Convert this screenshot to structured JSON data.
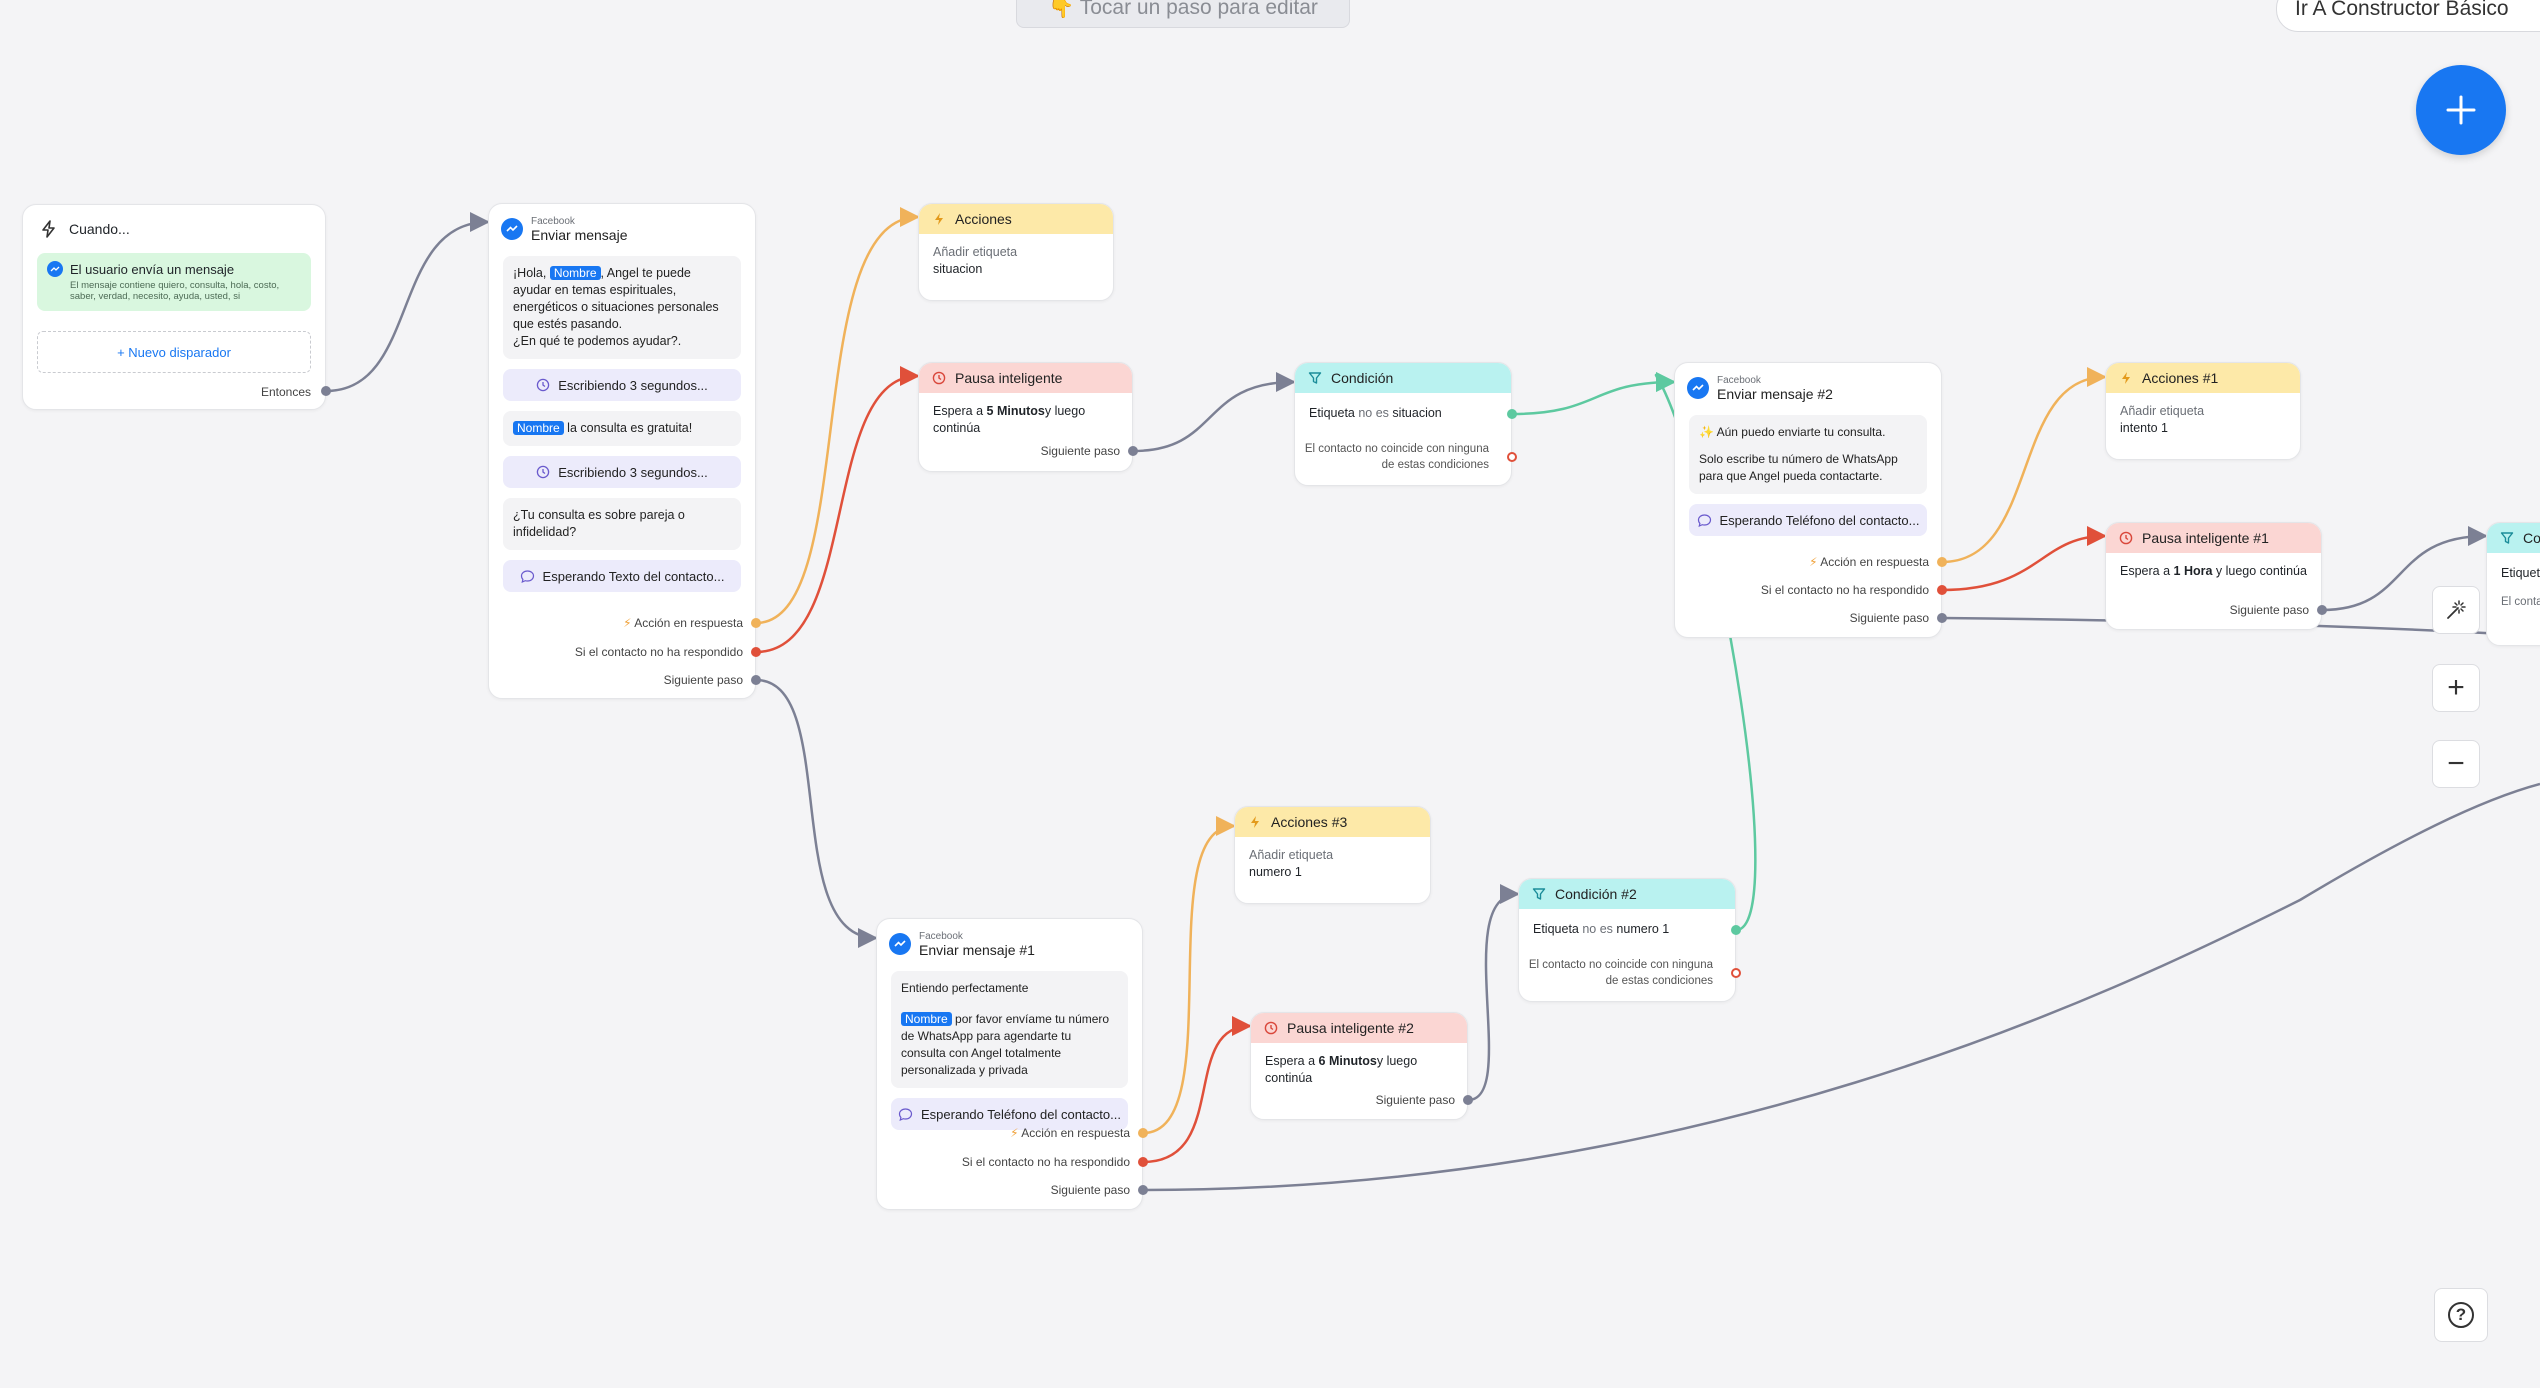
{
  "hint_banner": "👇 Tocar un paso para editar",
  "top_right_button": "Ir A Constructor Básico",
  "colors": {
    "facebook": "#1877f2",
    "yellow": "#fde9a8",
    "red": "#fbd6d3",
    "cyan": "#b9f2f0",
    "wire_gray": "#7c8094",
    "wire_orange": "#f0b25a",
    "wire_red": "#e0503a",
    "wire_green": "#5dc9a0"
  },
  "trigger": {
    "title": "Cuando...",
    "event_title": "El usuario envía un mensaje",
    "event_detail": "El mensaje contiene quiero, consulta, hola, costo, saber, verdad, necesito, ayuda, usted, si",
    "add_trigger": "+ Nuevo disparador",
    "port_then": "Entonces"
  },
  "msg1": {
    "source": "Facebook",
    "title": "Enviar mensaje",
    "b1_pre": "¡Hola, ",
    "b1_name": "Nombre",
    "b1_post": ", Angel te puede ayudar en temas espirituales, energéticos o situaciones personales que estés pasando.",
    "b1_line2": "¿En qué te podemos ayudar?.",
    "typing1": "Escribiendo 3 segundos...",
    "b2_name": "Nombre",
    "b2_post": " la consulta es gratuita!",
    "typing2": "Escribiendo 3 segundos...",
    "b3": "¿Tu consulta es sobre pareja o infidelidad?",
    "waiting": "Esperando Texto del contacto...",
    "port_action": "Acción en respuesta",
    "port_no_reply": "Si el contacto no ha respondido",
    "port_next": "Siguiente paso"
  },
  "actions": {
    "title": "Acciones",
    "label": "Añadir etiqueta",
    "value": "situacion"
  },
  "pause": {
    "title": "Pausa inteligente",
    "pre": "Espera a ",
    "bold": "5 Minutos",
    "post": "y luego continúa",
    "port_next": "Siguiente paso"
  },
  "condition": {
    "title": "Condición",
    "pre": "Etiqueta ",
    "mid": "no es",
    "value": "situacion",
    "else_text": "El contacto no coincide con ninguna de estas condiciones"
  },
  "msg2": {
    "source": "Facebook",
    "title": "Enviar mensaje #2",
    "line1": "✨ Aún puedo enviarte tu consulta.",
    "line2": "Solo escribe tu número de WhatsApp para que Angel pueda contactarte.",
    "waiting": "Esperando Teléfono del contacto...",
    "port_action": "Acción en respuesta",
    "port_no_reply": "Si el contacto no ha respondido",
    "port_next": "Siguiente paso"
  },
  "actions1": {
    "title": "Acciones #1",
    "label": "Añadir etiqueta",
    "value": "intento 1"
  },
  "pause1": {
    "title": "Pausa inteligente #1",
    "pre": "Espera a ",
    "bold": "1 Hora",
    "post": " y luego continúa",
    "port_next": "Siguiente paso"
  },
  "cond_partial": {
    "title": "Cond",
    "l1": "Etiqueta",
    "l2": "El conta"
  },
  "msg3": {
    "source": "Facebook",
    "title": "Enviar mensaje #1",
    "line1": "Entiendo perfectamente",
    "name": "Nombre",
    "line2": " por favor envíame tu número de WhatsApp para agendarte tu consulta con Angel totalmente personalizada y privada",
    "waiting": "Esperando Teléfono del contacto...",
    "port_action": "Acción en respuesta",
    "port_no_reply": "Si el contacto no ha respondido",
    "port_next": "Siguiente paso"
  },
  "actions3": {
    "title": "Acciones #3",
    "label": "Añadir etiqueta",
    "value": "numero 1"
  },
  "pause2": {
    "title": "Pausa inteligente #2",
    "pre": "Espera a ",
    "bold": "6 Minutos",
    "post": "y luego continúa",
    "port_next": "Siguiente paso"
  },
  "condition2": {
    "title": "Condición #2",
    "pre": "Etiqueta ",
    "mid": "no es",
    "value": "numero 1",
    "else_text": "El contacto no coincide con ninguna de estas condiciones"
  },
  "tools": {
    "add": "+",
    "zoom_in": "+",
    "zoom_out": "−",
    "help": "?"
  }
}
